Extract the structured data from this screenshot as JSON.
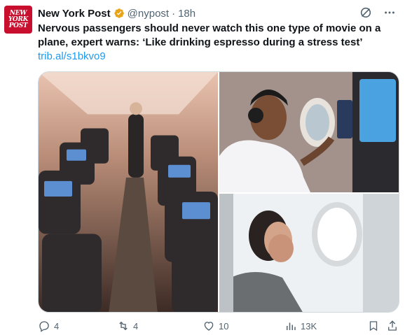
{
  "account": {
    "logo_lines": [
      "NEW",
      "YORK",
      "POST"
    ],
    "name": "New York Post",
    "handle": "@nypost",
    "separator": "·",
    "time": "18h",
    "verified_color": "#e8a317"
  },
  "post": {
    "text": "Nervous passengers should never watch this one type of movie on a plane, expert warns: ‘Like drinking espresso during a stress test’",
    "link": "trib.al/s1bkvo9"
  },
  "media": {
    "images": [
      {
        "alt": "airplane cabin aisle with seatback screens"
      },
      {
        "alt": "man with headphones touching seatback screen"
      },
      {
        "alt": "nervous woman covering her face by airplane window"
      }
    ]
  },
  "actions": {
    "replies": "4",
    "reposts": "4",
    "likes": "10",
    "views": "13K"
  },
  "icons": {
    "grok": "grok-icon",
    "more": "more-icon",
    "reply": "reply-icon",
    "repost": "repost-icon",
    "like": "heart-icon",
    "views": "views-icon",
    "bookmark": "bookmark-icon",
    "share": "share-icon"
  },
  "colors": {
    "text": "#0f1419",
    "secondary": "#536471",
    "link": "#1d9bf0",
    "brand": "#c8102e"
  }
}
